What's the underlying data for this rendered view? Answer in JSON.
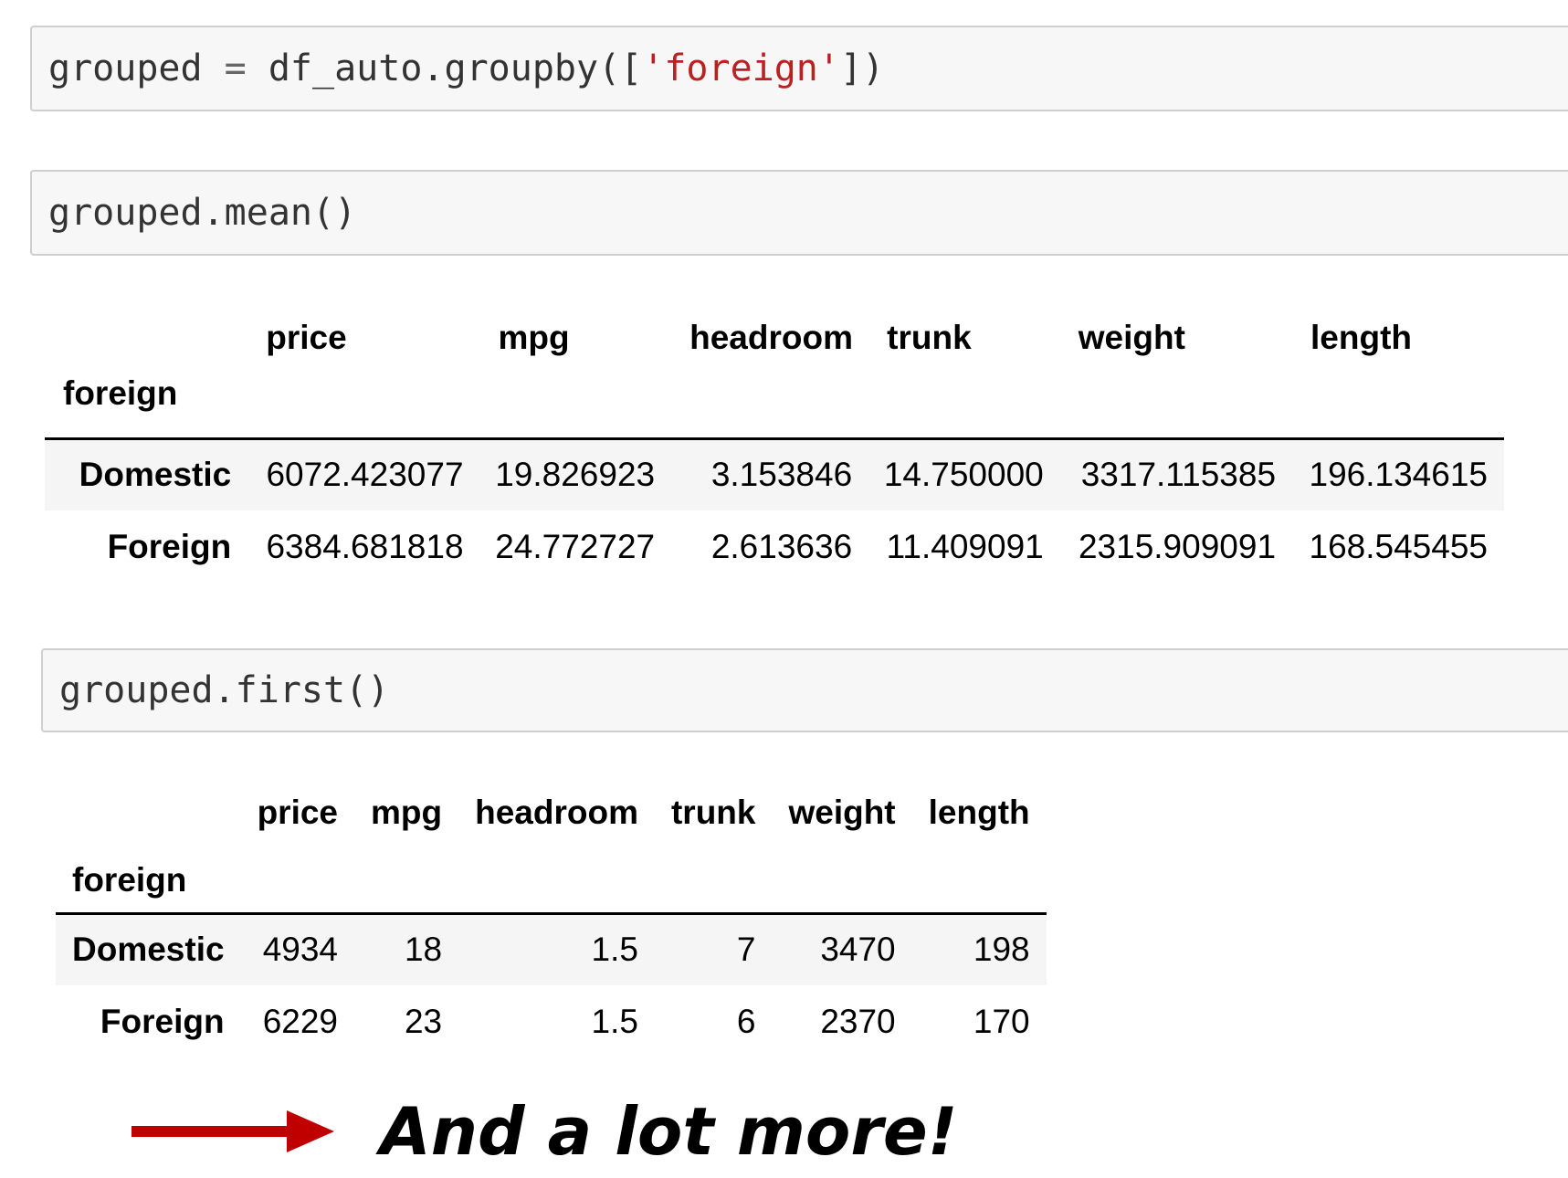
{
  "cells": [
    {
      "code_pre": "grouped ",
      "code_op": "=",
      "code_mid": " df_auto.groupby([",
      "code_str": "'foreign'",
      "code_post": "])"
    },
    {
      "code": "grouped.mean()"
    },
    {
      "code": "grouped.first()"
    }
  ],
  "mean_table": {
    "columns": [
      "price",
      "mpg",
      "headroom",
      "trunk",
      "weight",
      "length"
    ],
    "index_name": "foreign",
    "rows": [
      {
        "label": "Domestic",
        "values": [
          "6072.423077",
          "19.826923",
          "3.153846",
          "14.750000",
          "3317.115385",
          "196.134615"
        ]
      },
      {
        "label": "Foreign",
        "values": [
          "6384.681818",
          "24.772727",
          "2.613636",
          "11.409091",
          "2315.909091",
          "168.545455"
        ]
      }
    ]
  },
  "first_table": {
    "columns": [
      "price",
      "mpg",
      "headroom",
      "trunk",
      "weight",
      "length"
    ],
    "index_name": "foreign",
    "rows": [
      {
        "label": "Domestic",
        "values": [
          "4934",
          "18",
          "1.5",
          "7",
          "3470",
          "198"
        ]
      },
      {
        "label": "Foreign",
        "values": [
          "6229",
          "23",
          "1.5",
          "6",
          "2370",
          "170"
        ]
      }
    ]
  },
  "callout": {
    "text": "And a lot more!",
    "arrow_color": "#c00000"
  }
}
